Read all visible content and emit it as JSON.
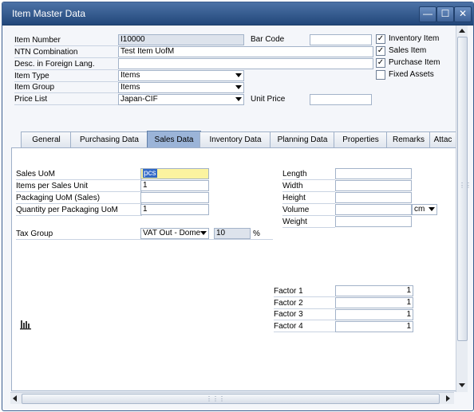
{
  "window": {
    "title": "Item Master Data",
    "minimize_glyph": "—",
    "maximize_glyph": "☐",
    "close_glyph": "✕"
  },
  "header": {
    "item_number_label": "Item Number",
    "item_number_value": "I10000",
    "ntn_label": "NTN Combination",
    "ntn_value": "Test Item UofM",
    "desc_foreign_label": "Desc. in Foreign Lang.",
    "desc_foreign_value": "",
    "item_type_label": "Item Type",
    "item_type_value": "Items",
    "item_group_label": "Item Group",
    "item_group_value": "Items",
    "price_list_label": "Price List",
    "price_list_value": "Japan-CIF",
    "bar_code_label": "Bar Code",
    "bar_code_value": "",
    "unit_price_label": "Unit Price",
    "unit_price_value": ""
  },
  "checkboxes": [
    {
      "label": "Inventory Item",
      "checked": true
    },
    {
      "label": "Sales Item",
      "checked": true
    },
    {
      "label": "Purchase Item",
      "checked": true
    },
    {
      "label": "Fixed Assets",
      "checked": false
    }
  ],
  "check_glyph": "✓",
  "tabs": [
    {
      "label": "General",
      "active": false
    },
    {
      "label": "Purchasing Data",
      "active": false
    },
    {
      "label": "Sales Data",
      "active": true
    },
    {
      "label": "Inventory Data",
      "active": false
    },
    {
      "label": "Planning Data",
      "active": false
    },
    {
      "label": "Properties",
      "active": false
    },
    {
      "label": "Remarks",
      "active": false
    },
    {
      "label": "Attac",
      "active": false
    }
  ],
  "sales": {
    "sales_uom_label": "Sales UoM",
    "sales_uom_value": "pcs",
    "items_per_unit_label": "Items per Sales Unit",
    "items_per_unit_value": "1",
    "packaging_uom_label": "Packaging UoM (Sales)",
    "packaging_uom_value": "",
    "qty_per_pkg_label": "Quantity per Packaging UoM",
    "qty_per_pkg_value": "1",
    "tax_group_label": "Tax Group",
    "tax_group_value": "VAT Out - Dome",
    "tax_rate_value": "10",
    "percent": "%",
    "length_label": "Length",
    "width_label": "Width",
    "height_label": "Height",
    "volume_label": "Volume",
    "volume_unit": "cm",
    "weight_label": "Weight",
    "factor1_label": "Factor 1",
    "factor1_value": "1",
    "factor2_label": "Factor 2",
    "factor2_value": "1",
    "factor3_label": "Factor 3",
    "factor3_value": "1",
    "factor4_label": "Factor 4",
    "factor4_value": "1"
  },
  "icons": {
    "chart": "bar-chart-icon",
    "grip": "⋮⋮",
    "hgrip": "⋮⋮⋮"
  }
}
